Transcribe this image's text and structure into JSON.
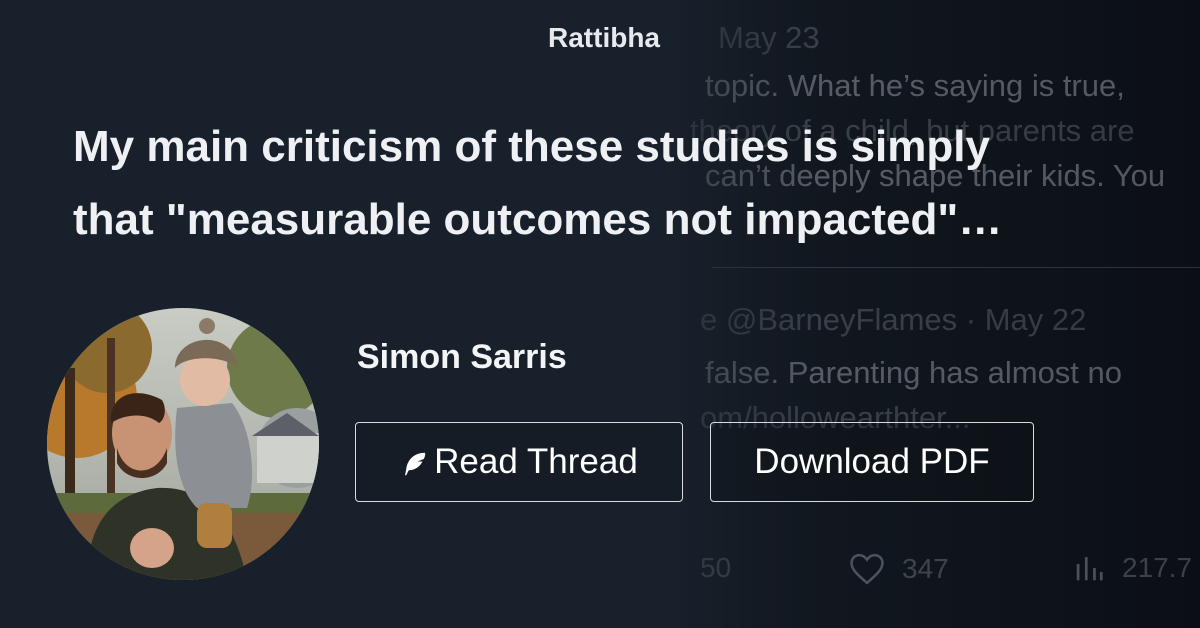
{
  "brand": "Rattibha",
  "headline": {
    "line1": "My main criticism of these studies is simply",
    "line2": "that \"measurable outcomes not impacted\"…"
  },
  "author": {
    "name": "Simon Sarris"
  },
  "buttons": {
    "read_thread": "Read Thread",
    "download_pdf": "Download PDF"
  },
  "background_tweet": {
    "date_top": "May 23",
    "line1": "topic. What he’s saying is true,",
    "line2": "theory of a child, but parents are",
    "line3": "can’t deeply shape their kids. You",
    "reply_meta": "e @BarneyFlames · May 22",
    "reply_line1": "false. Parenting has almost no",
    "reply_line2": "om/hollowearthter...",
    "stat_replies": "50",
    "stat_likes": "347",
    "stat_views": "217.7"
  },
  "colors": {
    "background": "#18202b",
    "text": "#eef0f3",
    "button_border": "#d8dbe0"
  },
  "icons": [
    "feather-icon",
    "heart-icon",
    "views-icon"
  ]
}
